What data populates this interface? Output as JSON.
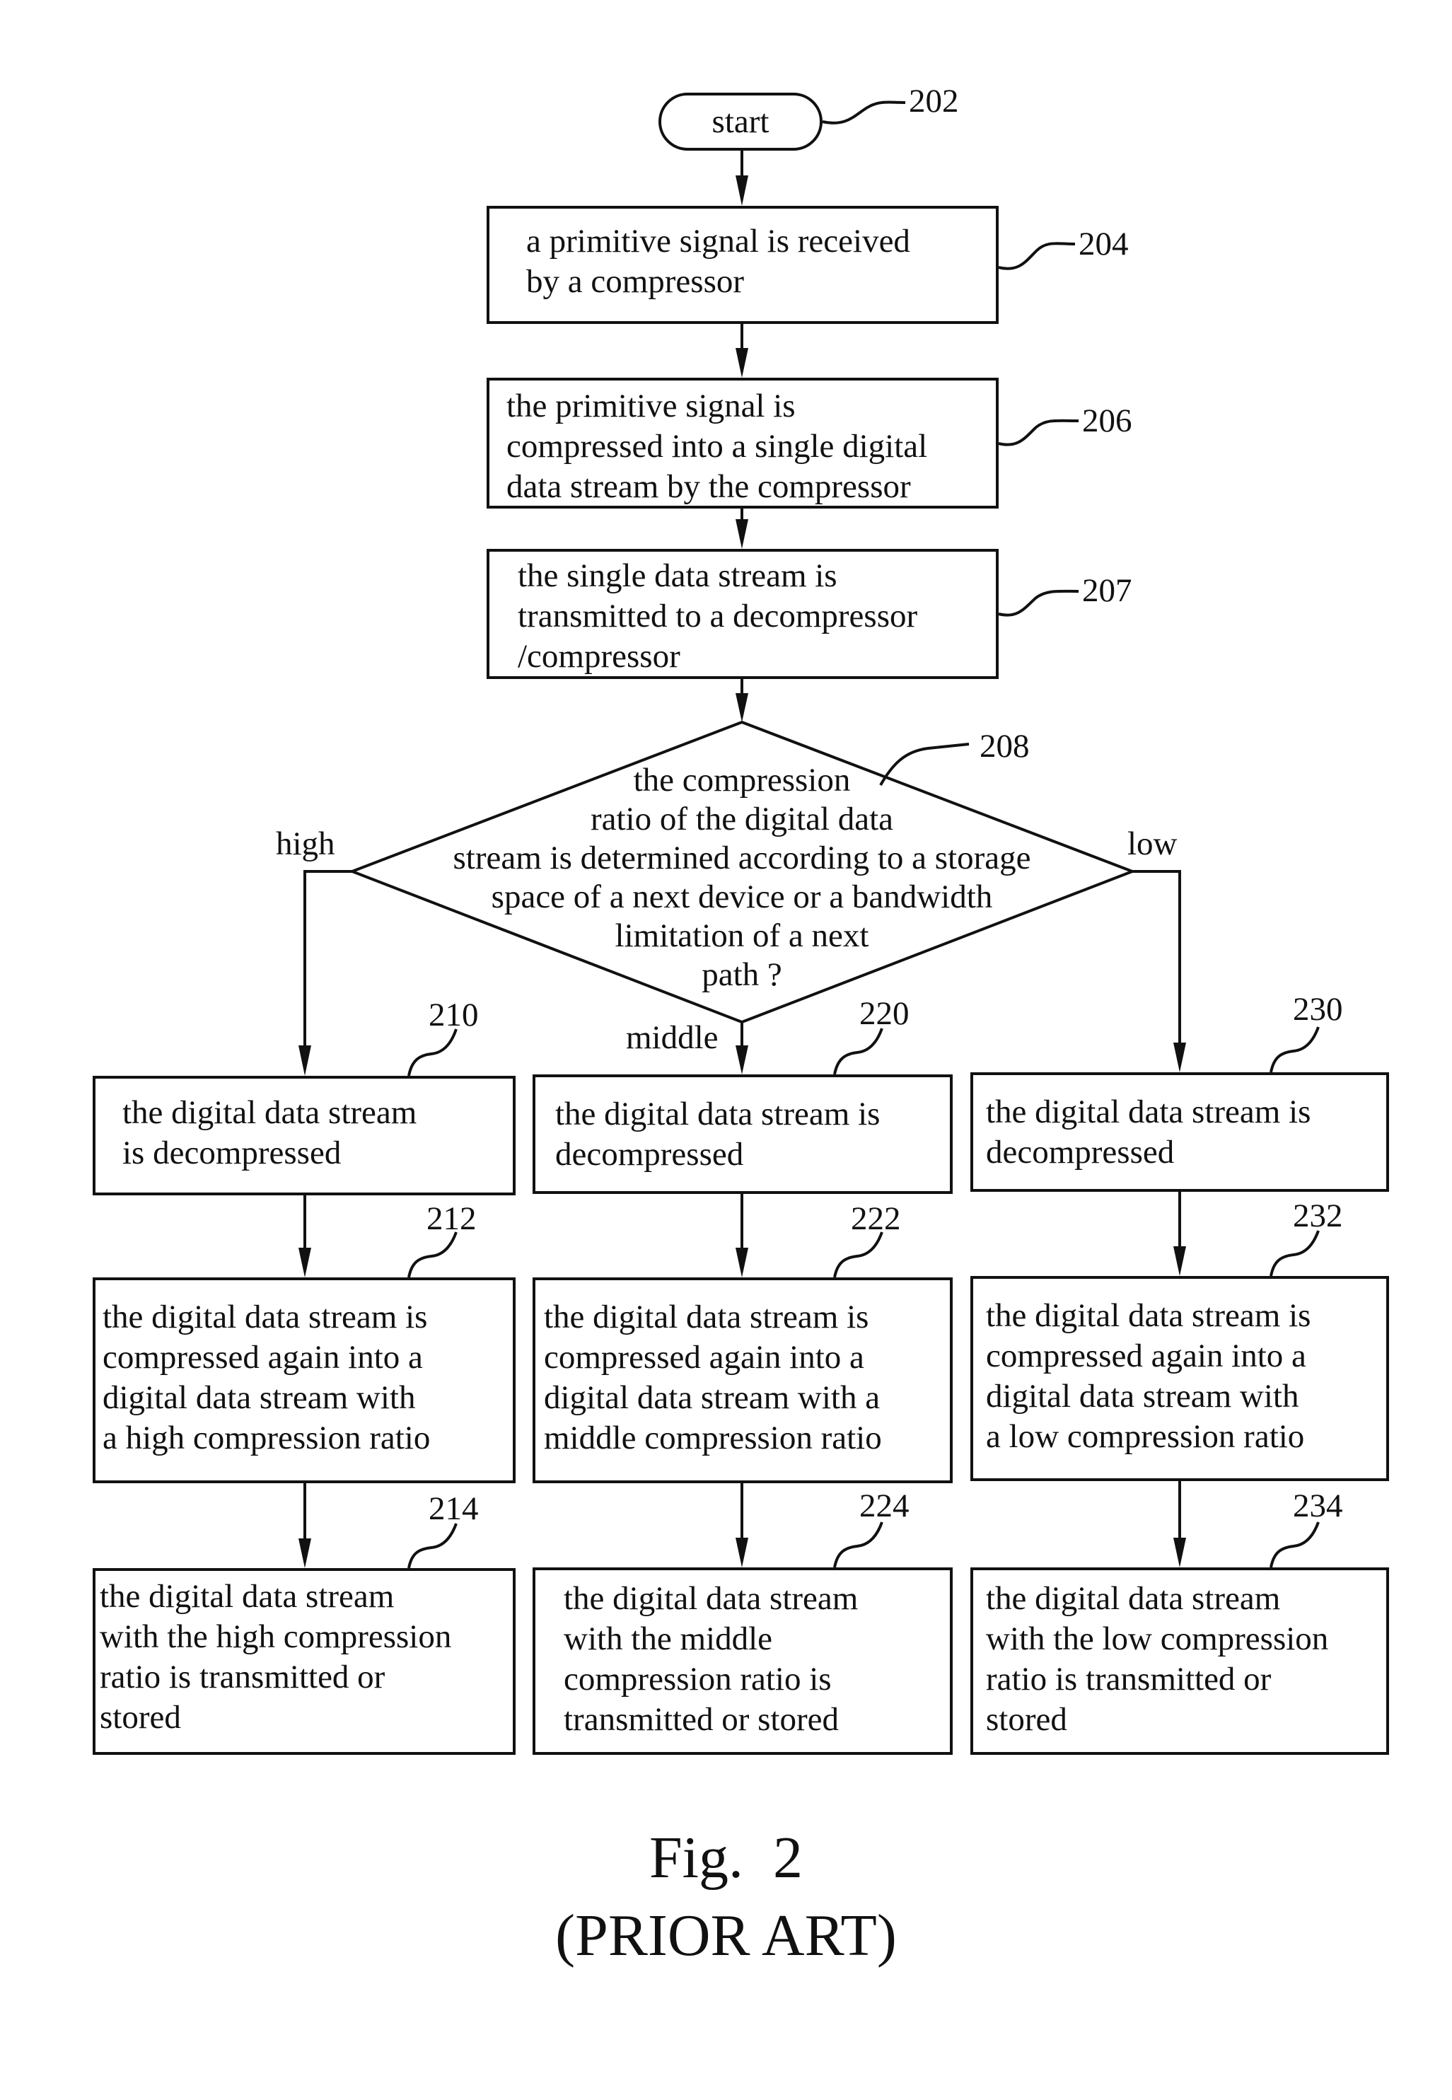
{
  "figure": {
    "caption": "Fig.  2",
    "subcaption": "(PRIOR ART)"
  },
  "nodes": {
    "start": {
      "ref": "202",
      "label": "start"
    },
    "n204": {
      "ref": "204",
      "lines": [
        "a primitive signal is received",
        "by a compressor"
      ]
    },
    "n206": {
      "ref": "206",
      "lines": [
        "the primitive signal is",
        "compressed into a single digital",
        "data stream by the compressor"
      ]
    },
    "n207": {
      "ref": "207",
      "lines": [
        "the single data stream is",
        "transmitted to a decompressor",
        "/compressor"
      ]
    },
    "n208": {
      "ref": "208",
      "lines": [
        "the compression",
        "ratio of the digital data",
        "stream is determined according to a storage",
        "space of a next device or a bandwidth",
        "limitation of a next",
        "path ?"
      ]
    },
    "n210": {
      "ref": "210",
      "lines": [
        "the digital data stream",
        "is decompressed"
      ]
    },
    "n212": {
      "ref": "212",
      "lines": [
        "the digital data stream is",
        "compressed again into a",
        "digital data stream with",
        "a high compression ratio"
      ]
    },
    "n214": {
      "ref": "214",
      "lines": [
        "the digital data stream",
        "with the high compression",
        "ratio is transmitted or",
        "stored"
      ]
    },
    "n220": {
      "ref": "220",
      "lines": [
        "the digital data stream is",
        "decompressed"
      ]
    },
    "n222": {
      "ref": "222",
      "lines": [
        "the digital data stream is",
        "compressed again into a",
        "digital data stream with a",
        "middle compression ratio"
      ]
    },
    "n224": {
      "ref": "224",
      "lines": [
        "the digital data stream",
        "with the middle",
        "compression ratio is",
        "transmitted or stored"
      ]
    },
    "n230": {
      "ref": "230",
      "lines": [
        "the digital data stream is",
        "decompressed"
      ]
    },
    "n232": {
      "ref": "232",
      "lines": [
        "the digital data stream is",
        "compressed again into a",
        "digital data stream with",
        "a low compression ratio"
      ]
    },
    "n234": {
      "ref": "234",
      "lines": [
        "the digital data stream",
        "with the low compression",
        "ratio is transmitted or",
        "stored"
      ]
    }
  },
  "branches": {
    "high": "high",
    "middle": "middle",
    "low": "low"
  }
}
